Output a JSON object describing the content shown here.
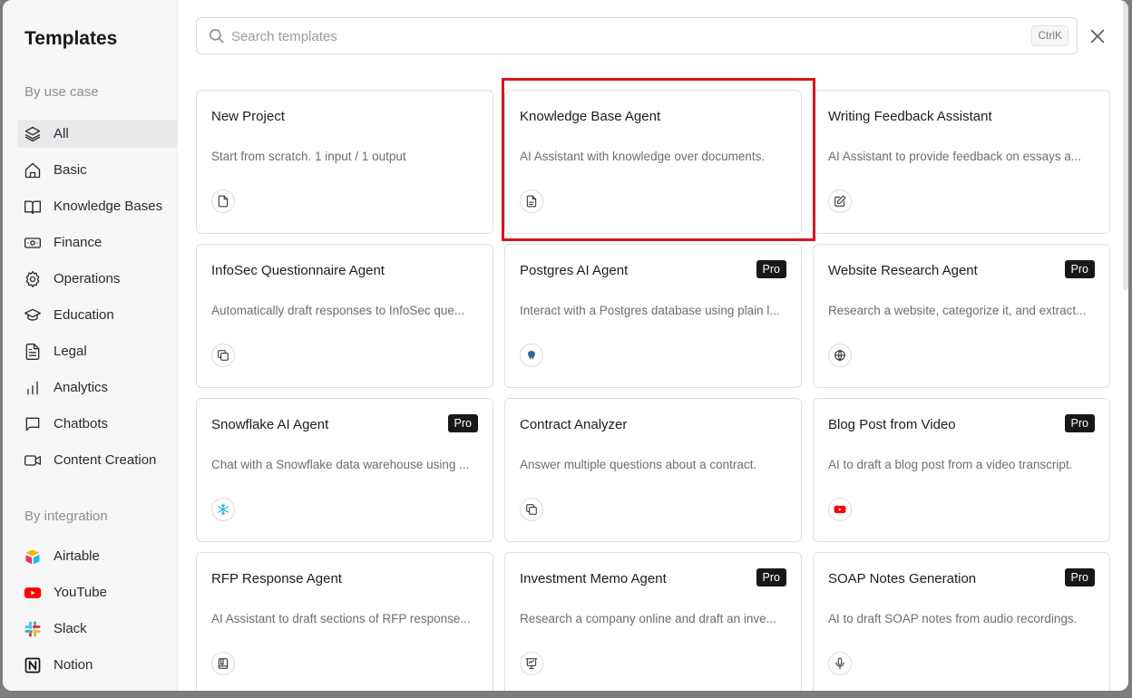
{
  "sidebar": {
    "title": "Templates",
    "use_case_heading": "By use case",
    "use_cases": [
      {
        "label": "All",
        "icon": "layers-icon",
        "active": true
      },
      {
        "label": "Basic",
        "icon": "home-icon"
      },
      {
        "label": "Knowledge Bases",
        "icon": "book-icon"
      },
      {
        "label": "Finance",
        "icon": "banknote-icon"
      },
      {
        "label": "Operations",
        "icon": "gear-icon"
      },
      {
        "label": "Education",
        "icon": "graduation-cap-icon"
      },
      {
        "label": "Legal",
        "icon": "document-icon"
      },
      {
        "label": "Analytics",
        "icon": "bar-chart-icon"
      },
      {
        "label": "Chatbots",
        "icon": "chat-icon"
      },
      {
        "label": "Content Creation",
        "icon": "video-icon"
      }
    ],
    "integration_heading": "By integration",
    "integrations": [
      {
        "label": "Airtable",
        "icon": "airtable-icon"
      },
      {
        "label": "YouTube",
        "icon": "youtube-icon"
      },
      {
        "label": "Slack",
        "icon": "slack-icon"
      },
      {
        "label": "Notion",
        "icon": "notion-icon"
      }
    ]
  },
  "search": {
    "placeholder": "Search templates",
    "shortcut": "CtrlK"
  },
  "pro_label": "Pro",
  "cards": [
    {
      "title": "New Project",
      "desc": "Start from scratch. 1 input / 1 output",
      "icon": "file-icon",
      "pro": false
    },
    {
      "title": "Knowledge Base Agent",
      "desc": "AI Assistant with knowledge over documents.",
      "icon": "file-text-icon",
      "pro": false
    },
    {
      "title": "Writing Feedback Assistant",
      "desc": "AI Assistant to provide feedback on essays a...",
      "icon": "pencil-icon",
      "pro": false
    },
    {
      "title": "InfoSec Questionnaire Agent",
      "desc": "Automatically draft responses to InfoSec que...",
      "icon": "copy-icon",
      "pro": false
    },
    {
      "title": "Postgres AI Agent",
      "desc": "Interact with a Postgres database using plain l...",
      "icon": "postgres-icon",
      "pro": true
    },
    {
      "title": "Website Research Agent",
      "desc": "Research a website, categorize it, and extract...",
      "icon": "globe-icon",
      "pro": true
    },
    {
      "title": "Snowflake AI Agent",
      "desc": "Chat with a Snowflake data warehouse using ...",
      "icon": "snowflake-icon",
      "pro": true
    },
    {
      "title": "Contract Analyzer",
      "desc": "Answer multiple questions about a contract.",
      "icon": "copy-icon",
      "pro": false
    },
    {
      "title": "Blog Post from Video",
      "desc": "AI to draft a blog post from a video transcript.",
      "icon": "youtube-icon",
      "pro": true
    },
    {
      "title": "RFP Response Agent",
      "desc": "AI Assistant to draft sections of RFP response...",
      "icon": "book-square-icon",
      "pro": false
    },
    {
      "title": "Investment Memo Agent",
      "desc": "Research a company online and draft an inve...",
      "icon": "presentation-icon",
      "pro": true
    },
    {
      "title": "SOAP Notes Generation",
      "desc": "AI to draft SOAP notes from audio recordings.",
      "icon": "microphone-icon",
      "pro": true
    }
  ]
}
